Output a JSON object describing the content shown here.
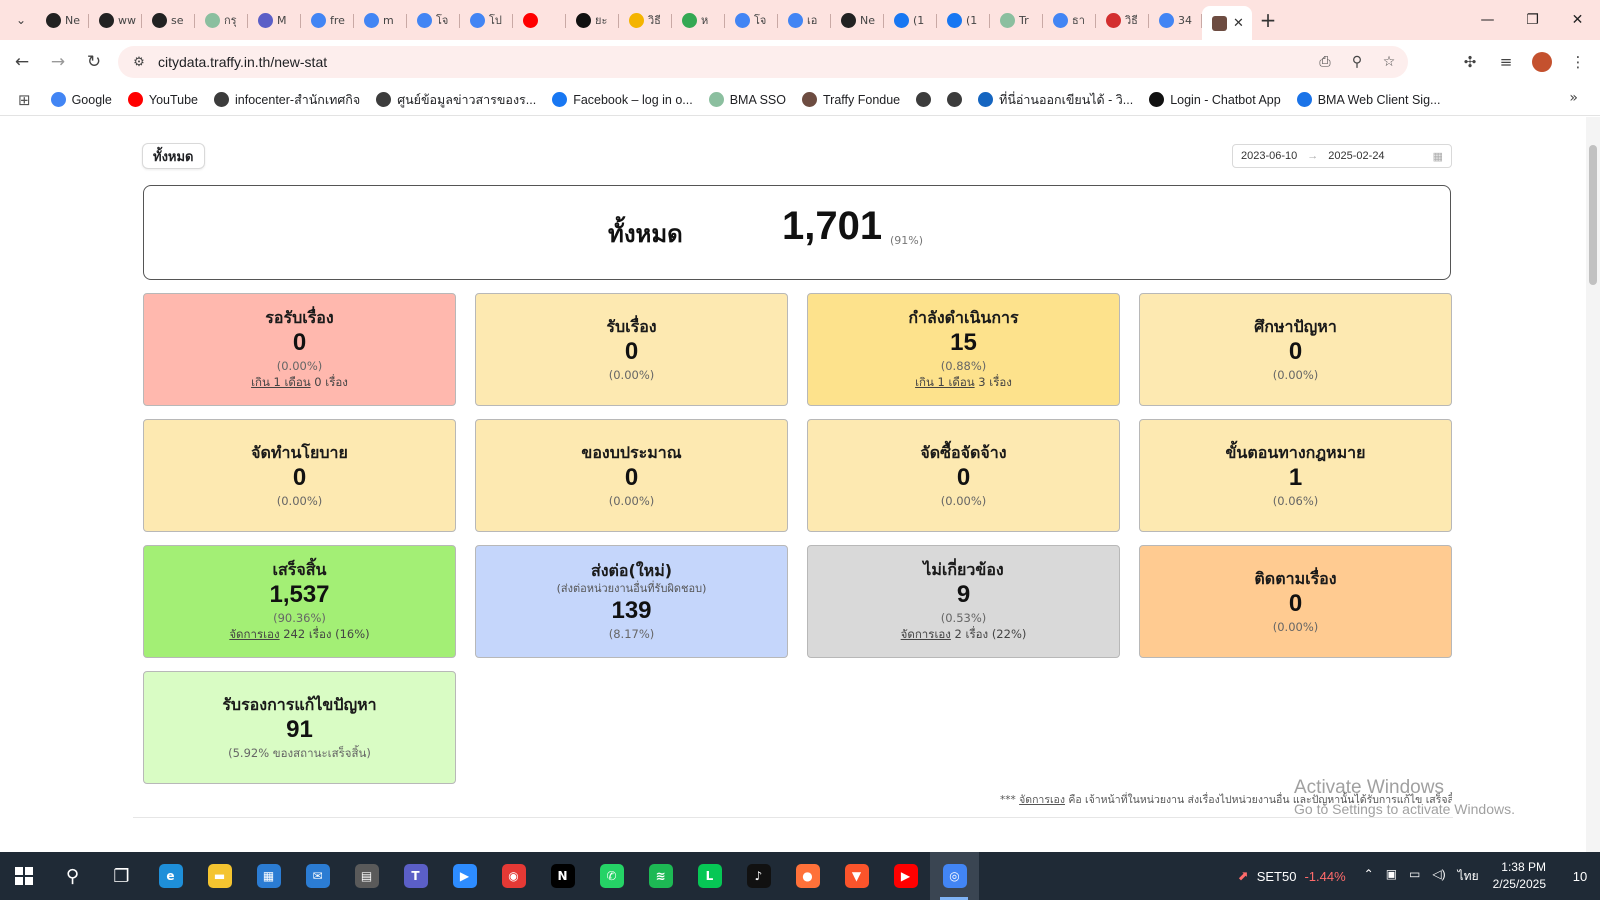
{
  "browser": {
    "tabs": [
      {
        "label": "Ne",
        "icon": "github-icon",
        "color": "#222222"
      },
      {
        "label": "ww",
        "icon": "github-icon",
        "color": "#222222"
      },
      {
        "label": "se",
        "icon": "github-icon",
        "color": "#222222"
      },
      {
        "label": "กรุ",
        "icon": "bma-icon",
        "color": "#8bbf9f"
      },
      {
        "label": "M",
        "icon": "teams-icon",
        "color": "#5b5fc7"
      },
      {
        "label": "fre",
        "icon": "google-icon",
        "color": "#4285f4"
      },
      {
        "label": "m",
        "icon": "google-icon",
        "color": "#4285f4"
      },
      {
        "label": "โจ",
        "icon": "google-icon",
        "color": "#4285f4"
      },
      {
        "label": "โป",
        "icon": "google-icon",
        "color": "#4285f4"
      },
      {
        "label": "",
        "icon": "youtube-icon",
        "color": "#ff0000"
      },
      {
        "label": "ยะ",
        "icon": "notion-icon",
        "color": "#111111"
      },
      {
        "label": "วิธี",
        "icon": "docs-icon",
        "color": "#f4b400"
      },
      {
        "label": "ห",
        "icon": "check-icon",
        "color": "#34a853"
      },
      {
        "label": "โจ",
        "icon": "google-icon",
        "color": "#4285f4"
      },
      {
        "label": "เอ",
        "icon": "docs-icon",
        "color": "#4285f4"
      },
      {
        "label": "Ne",
        "icon": "github-icon",
        "color": "#222222"
      },
      {
        "label": "(1",
        "icon": "facebook-icon",
        "color": "#1877f2"
      },
      {
        "label": "(1",
        "icon": "facebook-icon",
        "color": "#1877f2"
      },
      {
        "label": "Tr",
        "icon": "traffy-icon",
        "color": "#8bbf9f"
      },
      {
        "label": "ธา",
        "icon": "google-icon",
        "color": "#4285f4"
      },
      {
        "label": "วิธี",
        "icon": "app-icon",
        "color": "#d32f2f"
      },
      {
        "label": "34",
        "icon": "google-icon",
        "color": "#4285f4"
      }
    ],
    "active_tab_icon": "traffy-fondue-icon",
    "active_tab_color": "#6d4c41",
    "close_glyph": "✕",
    "new_tab_glyph": "+",
    "url": "citydata.traffy.in.th/new-stat",
    "bookmarks": [
      {
        "label": "Google",
        "icon": "google-icon",
        "color": "#4285f4"
      },
      {
        "label": "YouTube",
        "icon": "youtube-icon",
        "color": "#ff0000"
      },
      {
        "label": "infocenter-สำนักเทศกิจ",
        "icon": "globe-icon",
        "color": "#3c3c3c"
      },
      {
        "label": "ศูนย์ข้อมูลข่าวสารของร...",
        "icon": "globe-icon",
        "color": "#3c3c3c"
      },
      {
        "label": "Facebook – log in o...",
        "icon": "facebook-icon",
        "color": "#1877f2"
      },
      {
        "label": "BMA SSO",
        "icon": "bma-icon",
        "color": "#8bbf9f"
      },
      {
        "label": "Traffy Fondue",
        "icon": "traffy-fondue-icon",
        "color": "#6d4c41"
      },
      {
        "label": "",
        "icon": "globe-icon",
        "color": "#3c3c3c"
      },
      {
        "label": "",
        "icon": "globe-icon",
        "color": "#3c3c3c"
      },
      {
        "label": "ที่นี่อ่านออกเขียนได้ - วิ...",
        "icon": "cloud-icon",
        "color": "#1565c0"
      },
      {
        "label": "Login - Chatbot App",
        "icon": "chatbot-icon",
        "color": "#111111"
      },
      {
        "label": "BMA Web Client Sig...",
        "icon": "zimbra-icon",
        "color": "#1a73e8"
      }
    ]
  },
  "page": {
    "filter_label": "ทั้งหมด",
    "date_from": "2023-06-10",
    "date_to": "2025-02-24",
    "total": {
      "label": "ทั้งหมด",
      "value": "1,701",
      "pct": "(91%)"
    },
    "cards": [
      {
        "title": "รอรับเรื่อง",
        "value": "0",
        "pct": "(0.00%)",
        "note_link": "เกิน 1 เดือน",
        "note_text": " 0 เรื่อง",
        "bg": "#ffb8ae"
      },
      {
        "title": "รับเรื่อง",
        "value": "0",
        "pct": "(0.00%)",
        "bg": "#fde9b1"
      },
      {
        "title": "กำลังดำเนินการ",
        "value": "15",
        "pct": "(0.88%)",
        "note_link": "เกิน 1 เดือน",
        "note_text": " 3 เรื่อง",
        "bg": "#fde28c"
      },
      {
        "title": "ศึกษาปัญหา",
        "value": "0",
        "pct": "(0.00%)",
        "bg": "#fde9b1"
      },
      {
        "title": "จัดทำนโยบาย",
        "value": "0",
        "pct": "(0.00%)",
        "bg": "#fde9b1"
      },
      {
        "title": "ของบประมาณ",
        "value": "0",
        "pct": "(0.00%)",
        "bg": "#fde9b1"
      },
      {
        "title": "จัดซื้อจัดจ้าง",
        "value": "0",
        "pct": "(0.00%)",
        "bg": "#fde9b1"
      },
      {
        "title": "ขั้นตอนทางกฎหมาย",
        "value": "1",
        "pct": "(0.06%)",
        "bg": "#fde9b1"
      },
      {
        "title": "เสร็จสิ้น",
        "value": "1,537",
        "pct": "(90.36%)",
        "note_link": "จัดการเอง",
        "note_text": " 242 เรื่อง (16%)",
        "bg": "#a3ef75"
      },
      {
        "title": "ส่งต่อ(ใหม่)",
        "subtitle": "(ส่งต่อหน่วยงานอื่นที่รับผิดชอบ)",
        "value": "139",
        "pct": "(8.17%)",
        "bg": "#c5d6fb"
      },
      {
        "title": "ไม่เกี่ยวข้อง",
        "value": "9",
        "pct": "(0.53%)",
        "note_link": "จัดการเอง",
        "note_text": " 2 เรื่อง (22%)",
        "bg": "#d9d9d9"
      },
      {
        "title": "ติดตามเรื่อง",
        "value": "0",
        "pct": "(0.00%)",
        "bg": "#ffcb91"
      },
      {
        "title": "รับรองการแก้ไขปัญหา",
        "value": "91",
        "pct": "(5.92% ของสถานะเสร็จสิ้น)",
        "bg": "#d9fcc4"
      }
    ],
    "footnote_prefix": "*** ",
    "footnote_link": "จัดการเอง",
    "footnote_text": " คือ เจ้าหน้าที่ในหน่วยงาน ส่งเรื่องไปหน่วยงานอื่น และปัญหานั้นได้รับการแก้ไข เสร็จสิ้นแล้ว"
  },
  "watermark": {
    "line1": "Activate Windows",
    "line2": "Go to Settings to activate Windows."
  },
  "taskbar": {
    "apps": [
      {
        "name": "search-icon",
        "color": "transparent",
        "glyph": "⚲"
      },
      {
        "name": "task-view-icon",
        "color": "transparent",
        "glyph": "❐"
      },
      {
        "name": "edge-icon",
        "color": "#1e8fd9",
        "glyph": "e"
      },
      {
        "name": "file-explorer-icon",
        "color": "#f4c430",
        "glyph": "▬"
      },
      {
        "name": "store-icon",
        "color": "#2b7cd3",
        "glyph": "▦"
      },
      {
        "name": "mail-icon",
        "color": "#2b7cd3",
        "glyph": "✉"
      },
      {
        "name": "calculator-icon",
        "color": "#5a5a5a",
        "glyph": "▤"
      },
      {
        "name": "teams-icon",
        "color": "#5b5fc7",
        "glyph": "T"
      },
      {
        "name": "zoom-icon",
        "color": "#2d8cff",
        "glyph": "▶"
      },
      {
        "name": "record-icon",
        "color": "#e53935",
        "glyph": "◉"
      },
      {
        "name": "netflix-icon",
        "color": "#000000",
        "glyph": "N"
      },
      {
        "name": "whatsapp-icon",
        "color": "#25d366",
        "glyph": "✆"
      },
      {
        "name": "spotify-icon",
        "color": "#1db954",
        "glyph": "≋"
      },
      {
        "name": "line-icon",
        "color": "#06c755",
        "glyph": "L"
      },
      {
        "name": "tiktok-icon",
        "color": "#111111",
        "glyph": "♪"
      },
      {
        "name": "firefox-icon",
        "color": "#ff7139",
        "glyph": "●"
      },
      {
        "name": "brave-icon",
        "color": "#fb542b",
        "glyph": "▼"
      },
      {
        "name": "youtube-icon",
        "color": "#ff0000",
        "glyph": "▶"
      },
      {
        "name": "chrome-icon",
        "color": "#4285f4",
        "glyph": "◎"
      }
    ],
    "stock_name": "SET50",
    "stock_change": "-1.44%",
    "lang": "ไทย",
    "time": "1:38 PM",
    "date": "2/25/2025",
    "notifications": "10"
  }
}
